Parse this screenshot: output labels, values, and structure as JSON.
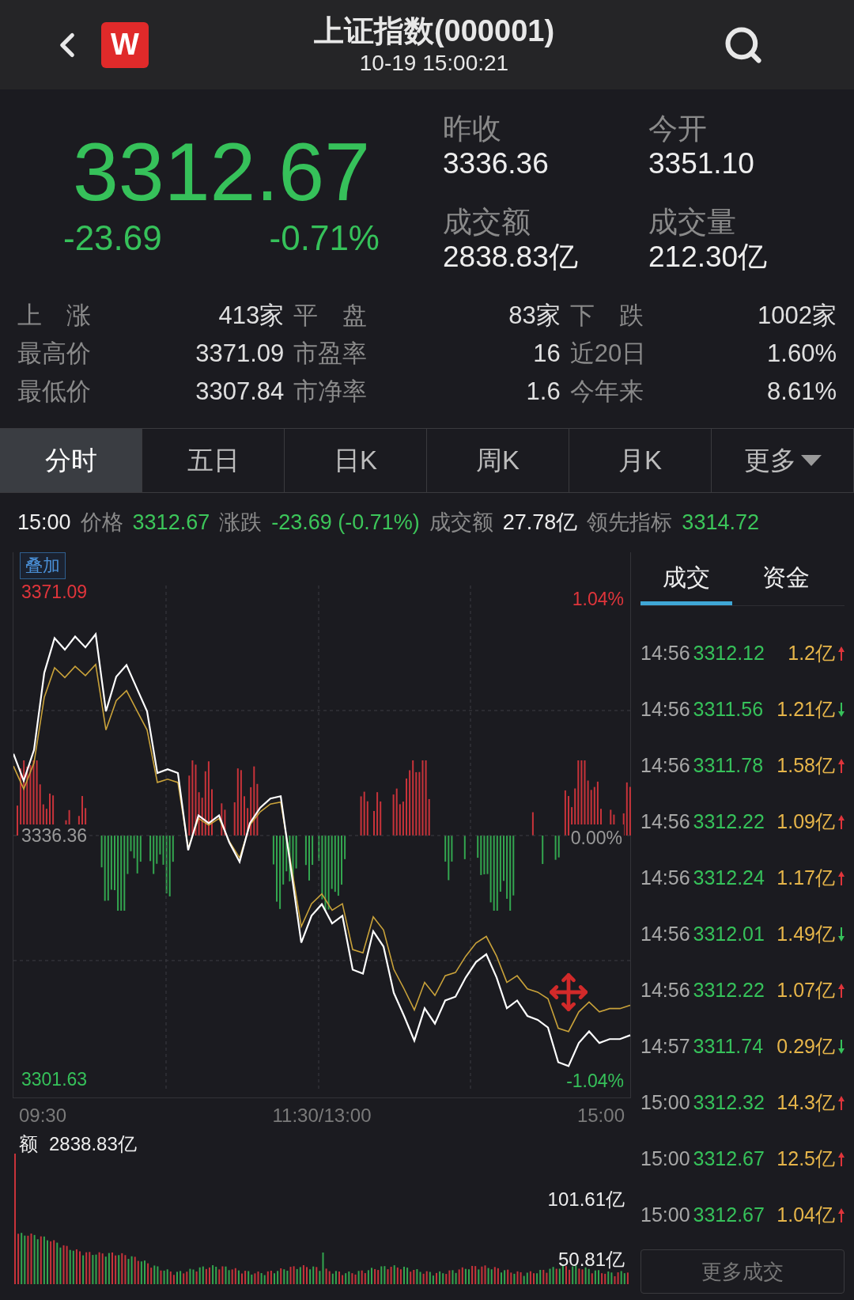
{
  "header": {
    "logo_letter": "W",
    "title": "上证指数(000001)",
    "time": "10-19 15:00:21"
  },
  "quote": {
    "price": "3312.67",
    "change": "-23.69",
    "change_pct": "-0.71%",
    "stats": [
      {
        "label": "昨收",
        "value": "3336.36"
      },
      {
        "label": "今开",
        "value": "3351.10"
      },
      {
        "label": "成交额",
        "value": "2838.83亿"
      },
      {
        "label": "成交量",
        "value": "212.30亿"
      }
    ]
  },
  "market_stats": [
    {
      "label": "上　涨",
      "value": "413家"
    },
    {
      "label": "平　盘",
      "value": "83家"
    },
    {
      "label": "下　跌",
      "value": "1002家"
    },
    {
      "label": "最高价",
      "value": "3371.09"
    },
    {
      "label": "市盈率",
      "value": "16"
    },
    {
      "label": "近20日",
      "value": "1.60%"
    },
    {
      "label": "最低价",
      "value": "3307.84"
    },
    {
      "label": "市净率",
      "value": "1.6"
    },
    {
      "label": "今年来",
      "value": "8.61%"
    }
  ],
  "tabs": [
    {
      "label": "分时",
      "selected": true,
      "kind": "plain"
    },
    {
      "label": "五日",
      "selected": false,
      "kind": "plain"
    },
    {
      "label": "日K",
      "selected": false,
      "kind": "plain"
    },
    {
      "label": "周K",
      "selected": false,
      "kind": "plain"
    },
    {
      "label": "月K",
      "selected": false,
      "kind": "plain"
    },
    {
      "label": "更多",
      "selected": false,
      "kind": "menu"
    }
  ],
  "info_line": {
    "time": "15:00",
    "items": [
      {
        "label": "价格",
        "value": "3312.67",
        "color": "#3cc65a"
      },
      {
        "label": "涨跌",
        "value": "-23.69 (-0.71%)",
        "color": "#3cc65a"
      },
      {
        "label": "成交额",
        "value": "27.78亿",
        "color": "#eeeeee"
      },
      {
        "label": "领先指标",
        "value": "3314.72",
        "color": "#3cc65a"
      }
    ]
  },
  "chart": {
    "overlay_button": "叠加",
    "high_pct": "1.04%",
    "zero_pct": "0.00%",
    "low_pct": "-1.04%",
    "time_axis": [
      "09:30",
      "11:30/13:00",
      "15:00"
    ],
    "chart_data": {
      "type": "line",
      "categories": [
        null,
        null,
        null,
        null,
        null,
        null,
        null,
        null,
        null,
        null,
        null,
        null,
        null,
        null,
        null,
        null,
        null,
        null,
        null,
        null,
        null,
        null,
        null,
        null,
        null,
        null,
        null,
        null,
        null,
        null,
        null,
        null,
        null,
        null,
        null,
        null,
        null,
        null,
        null,
        null,
        null,
        null,
        null,
        null,
        null,
        null,
        null,
        null,
        null,
        null,
        null,
        null,
        null,
        null,
        null,
        null,
        null,
        null,
        null,
        null,
        null
      ],
      "series": [
        {
          "color": "#ffffff",
          "values": [
            3348.01,
            3344.16,
            3348.56,
            3359.55,
            3364.5,
            3362.85,
            3364.72,
            3363.18,
            3365.05,
            3354.06,
            3359.0,
            3360.65,
            3357.35,
            3354.06,
            3345.26,
            3345.81,
            3345.26,
            3334.27,
            3339.22,
            3338.12,
            3339.22,
            3335.37,
            3332.62,
            3338.12,
            3340.32,
            3341.64,
            3341.97,
            3331.53,
            3321.09,
            3324.93,
            3326.58,
            3323.84,
            3324.93,
            3317.24,
            3316.69,
            3322.73,
            3320.54,
            3313.94,
            3310.65,
            3307.13,
            3311.74,
            3309.55,
            3312.85,
            3313.39,
            3316.14,
            3318.34,
            3319.44,
            3316.14,
            3311.74,
            3312.85,
            3310.65,
            3310.1,
            3309.0,
            3304.05,
            3303.5,
            3306.8,
            3308.45,
            3306.8,
            3307.35,
            3307.35,
            3307.9
          ]
        },
        {
          "color": "#c9a23a",
          "values": [
            3346.26,
            3342.99,
            3346.73,
            3356.07,
            3360.28,
            3358.88,
            3360.47,
            3359.16,
            3360.75,
            3351.41,
            3355.6,
            3357.01,
            3354.2,
            3351.41,
            3343.93,
            3344.39,
            3343.93,
            3334.58,
            3338.79,
            3337.86,
            3338.79,
            3335.52,
            3333.18,
            3337.86,
            3339.73,
            3340.85,
            3341.13,
            3332.25,
            3323.38,
            3326.64,
            3328.05,
            3325.72,
            3326.64,
            3320.11,
            3319.64,
            3324.77,
            3322.91,
            3317.3,
            3314.51,
            3311.51,
            3315.43,
            3313.57,
            3316.38,
            3316.84,
            3319.17,
            3321.04,
            3321.98,
            3319.17,
            3315.43,
            3316.38,
            3314.51,
            3314.04,
            3313.1,
            3308.9,
            3308.43,
            3311.23,
            3312.64,
            3311.23,
            3311.7,
            3311.7,
            3312.17
          ]
        }
      ],
      "ylim": [
        3298.92,
        3376.73
      ],
      "yticks": [
        {
          "value": 3371.09,
          "label": "3371.09"
        },
        {
          "value": 3336.36,
          "label": "3336.36"
        },
        {
          "value": 3301.63,
          "label": "3301.63"
        }
      ]
    }
  },
  "volume": {
    "total_label": "额",
    "total": "2838.83亿",
    "ticks": [
      "101.61亿",
      "50.81亿"
    ]
  },
  "trades": {
    "tabs": [
      {
        "label": "成交",
        "selected": true
      },
      {
        "label": "资金",
        "selected": false
      }
    ],
    "rows": [
      {
        "time": "14:56",
        "price": "3312.12",
        "amount": "1.2亿",
        "rising": true
      },
      {
        "time": "14:56",
        "price": "3311.56",
        "amount": "1.21亿",
        "rising": false
      },
      {
        "time": "14:56",
        "price": "3311.78",
        "amount": "1.58亿",
        "rising": true
      },
      {
        "time": "14:56",
        "price": "3312.22",
        "amount": "1.09亿",
        "rising": true
      },
      {
        "time": "14:56",
        "price": "3312.24",
        "amount": "1.17亿",
        "rising": true
      },
      {
        "time": "14:56",
        "price": "3312.01",
        "amount": "1.49亿",
        "rising": false
      },
      {
        "time": "14:56",
        "price": "3312.22",
        "amount": "1.07亿",
        "rising": true
      },
      {
        "time": "14:57",
        "price": "3311.74",
        "amount": "0.29亿",
        "rising": false
      },
      {
        "time": "15:00",
        "price": "3312.32",
        "amount": "14.3亿",
        "rising": true
      },
      {
        "time": "15:00",
        "price": "3312.67",
        "amount": "12.5亿",
        "rising": true
      },
      {
        "time": "15:00",
        "price": "3312.67",
        "amount": "1.04亿",
        "rising": true
      }
    ],
    "more_button": "更多成交"
  }
}
